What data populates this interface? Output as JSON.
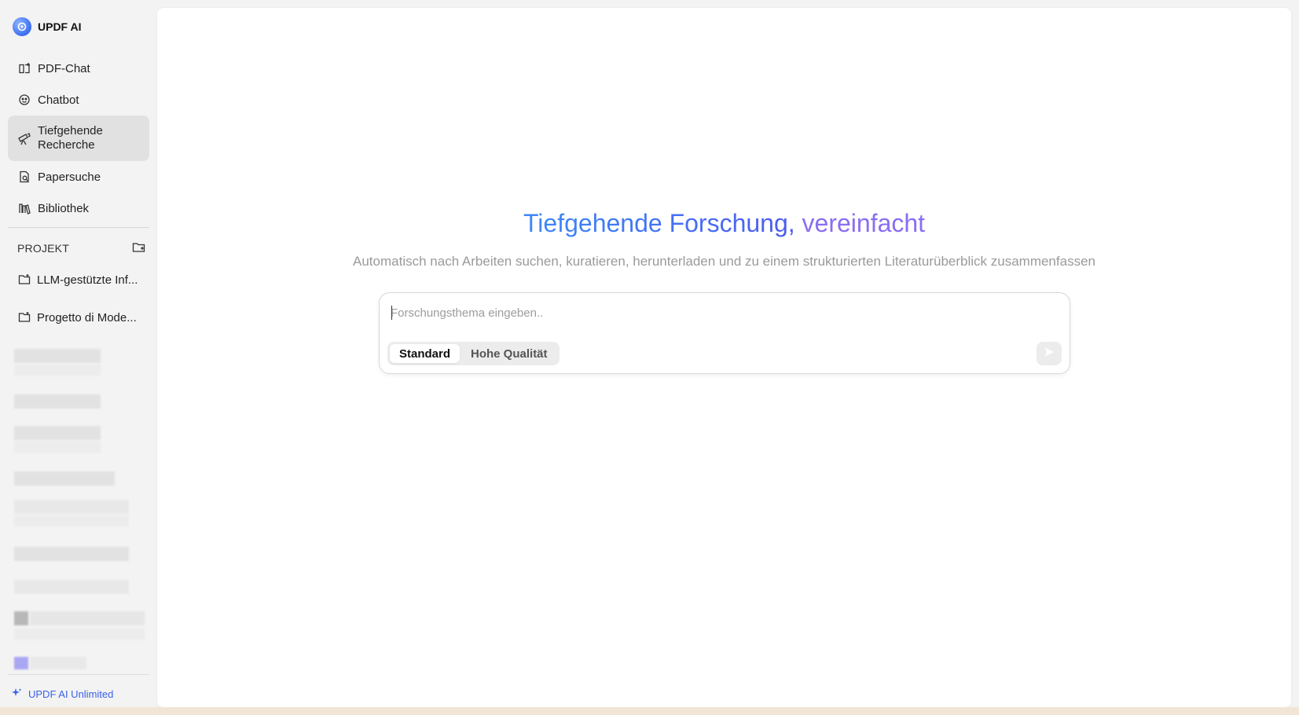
{
  "app": {
    "name": "UPDF AI"
  },
  "sidebar": {
    "items": [
      {
        "label": "PDF-Chat",
        "icon": "book-icon"
      },
      {
        "label": "Chatbot",
        "icon": "bot-icon"
      },
      {
        "label": "Tiefgehende Recherche",
        "icon": "telescope-icon",
        "active": true
      },
      {
        "label": "Papersuche",
        "icon": "doc-search-icon"
      },
      {
        "label": "Bibliothek",
        "icon": "library-icon"
      }
    ],
    "project_header": "PROJEKT",
    "projects": [
      {
        "label": "LLM-gestützte Inf..."
      },
      {
        "label": "Progetto di Mode..."
      }
    ],
    "footer_link": "UPDF AI Unlimited"
  },
  "main": {
    "title_part1": "Tiefgehende Forschung,",
    "title_part2": "vereinfacht",
    "subtitle": "Automatisch nach Arbeiten suchen, kuratieren, herunterladen und zu einem strukturierten Literaturüberblick zusammenfassen",
    "input": {
      "placeholder": "Forschungsthema eingeben..",
      "value": ""
    },
    "modes": [
      {
        "label": "Standard",
        "selected": true
      },
      {
        "label": "Hohe Qualität",
        "selected": false
      }
    ]
  },
  "colors": {
    "accent_blue": "#3d8af7",
    "accent_indigo": "#4d5bf0",
    "accent_violet": "#8a6df2",
    "link_blue": "#3a62e6"
  }
}
